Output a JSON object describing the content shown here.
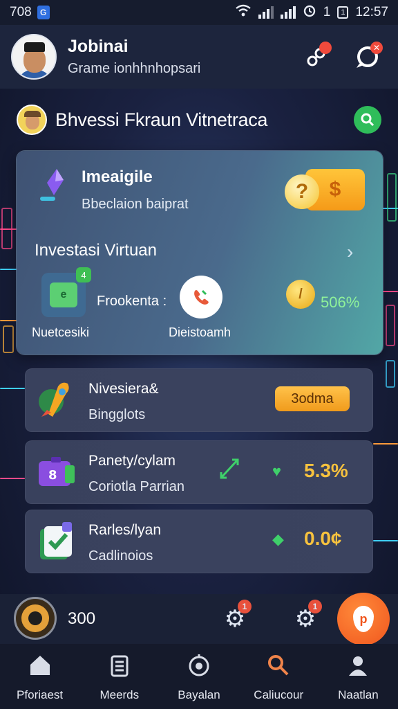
{
  "status_bar": {
    "left_text": "708",
    "battery": "1",
    "time": "12:57",
    "battery_label": "1"
  },
  "profile": {
    "name": "Jobinai",
    "subtitle": "Grame ionhhnhopsari"
  },
  "section": {
    "title": "Bhvessi Fkraun Vitnetraca"
  },
  "main_card": {
    "title": "Imeaigile",
    "subtitle": "Bbeclaion baiprat",
    "investasi": "Investasi Virtuan",
    "label_left": "Nuetcesiki",
    "label_mid": "Frookenta :",
    "label_phone": "Dieistoamh",
    "percent": "506%"
  },
  "list": [
    {
      "title": "Nivesiera&",
      "sub": "Bingglots",
      "action": "3odma"
    },
    {
      "title": "Panety/cylam",
      "sub": "Coriotla Parrian",
      "value": "5.3%"
    },
    {
      "title": "Rarles/lyan",
      "sub": "Cadlinoios",
      "value": "0.0¢"
    }
  ],
  "action_bar": {
    "count": "300",
    "gear1_badge": "1",
    "gear2_badge": "1"
  },
  "nav": [
    {
      "label": "Pforiaest",
      "icon": "home-icon"
    },
    {
      "label": "Meerds",
      "icon": "clipboard-icon"
    },
    {
      "label": "Bayalan",
      "icon": "timer-icon"
    },
    {
      "label": "Caliucour",
      "icon": "search-icon"
    },
    {
      "label": "Naatlan",
      "icon": "user-icon"
    }
  ],
  "colors": {
    "accent": "#f7c23e",
    "positive": "#8ff29a",
    "badge": "#f04a3c"
  }
}
